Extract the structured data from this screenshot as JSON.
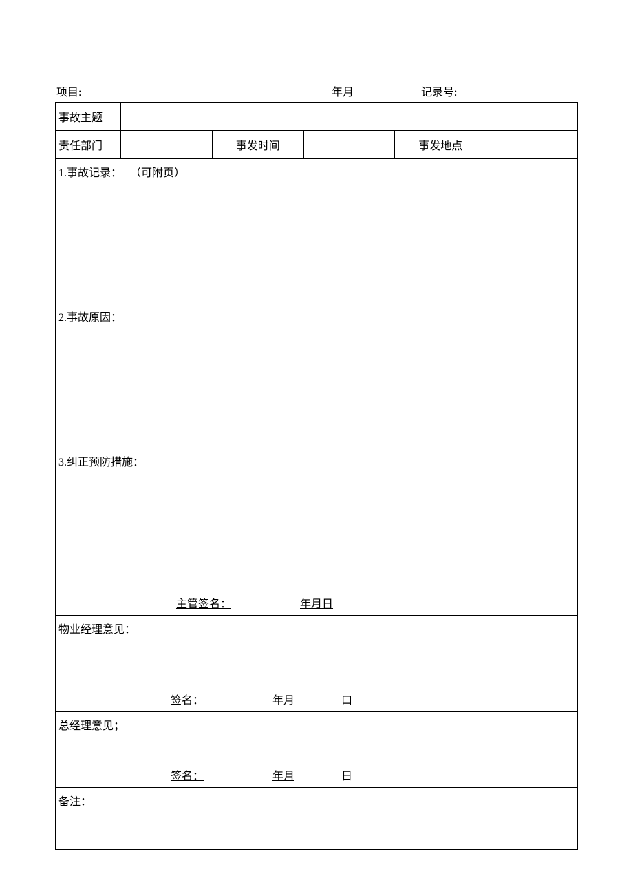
{
  "header": {
    "project_label": "项目:",
    "date_label": "年月",
    "record_label": "记录号:"
  },
  "row1": {
    "subject_label": "事故主题"
  },
  "row2": {
    "dept_label": "责任部门",
    "time_label": "事发时间",
    "location_label": "事发地点"
  },
  "sections": {
    "s1_title": "1.事故记录：",
    "s1_note": "（可附页）",
    "s2_title": "2.事故原因：",
    "s3_title": "3.纠正预防措施：",
    "sig_supervisor": "主管签名：",
    "sig_date_ymd": "年月日"
  },
  "pm": {
    "title": "物业经理意见：",
    "sig_label": "签名：",
    "date_ym": "年月",
    "date_day": "口"
  },
  "gm": {
    "title": "总经理意见；",
    "sig_label": "签名：",
    "date_ym": "年月",
    "date_day": "日"
  },
  "note": {
    "title": "备注："
  }
}
